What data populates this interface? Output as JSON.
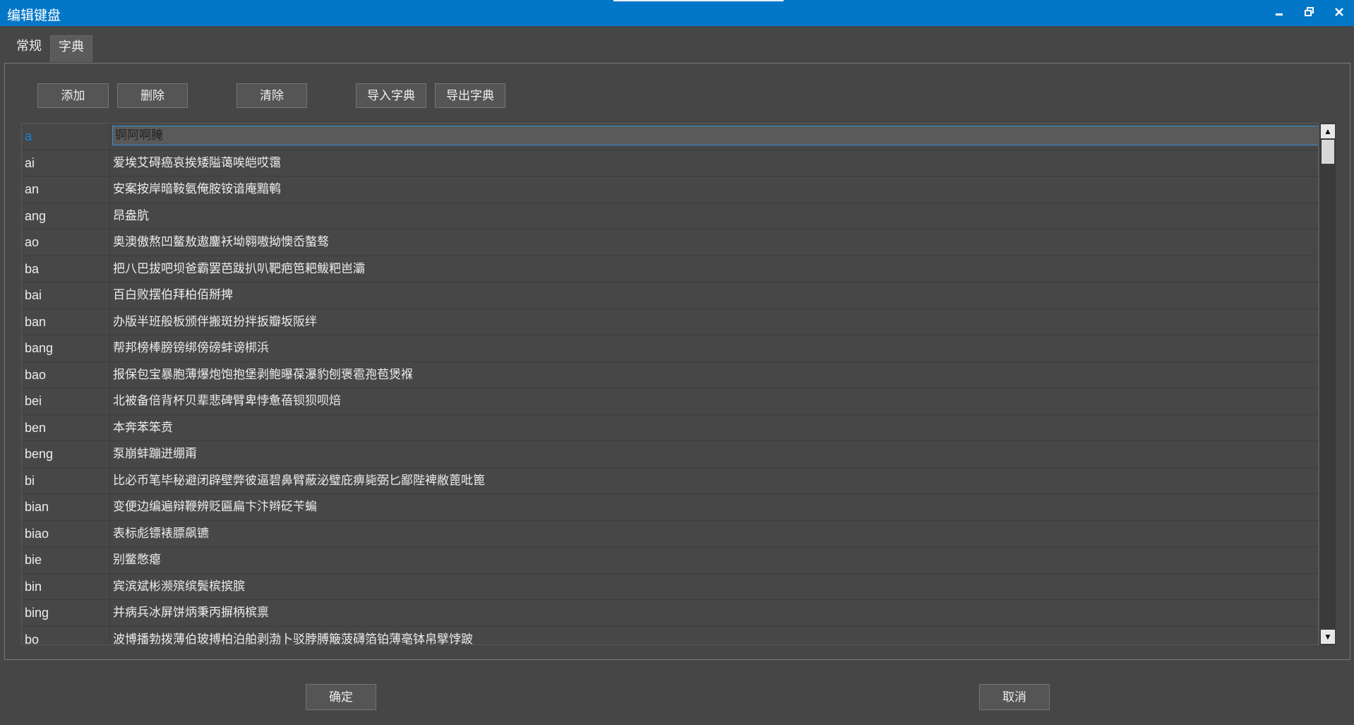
{
  "window": {
    "title": "编辑键盘"
  },
  "tabs": [
    {
      "label": "常规"
    },
    {
      "label": "字典"
    }
  ],
  "toolbar": {
    "add": "添加",
    "delete": "删除",
    "clear": "清除",
    "import": "导入字典",
    "export": "导出字典"
  },
  "edit_value": "锕阿啊腌",
  "rows": [
    {
      "key": "a",
      "value": "锕阿啊腌"
    },
    {
      "key": "ai",
      "value": "爱埃艾碍癌哀挨矮隘蔼唉皑哎霭"
    },
    {
      "key": "an",
      "value": "安案按岸暗鞍氨俺胺铵谙庵黯鹌"
    },
    {
      "key": "ang",
      "value": "昂盎肮"
    },
    {
      "key": "ao",
      "value": "奥澳傲熬凹鳌敖遨鏖袄坳翱嗷拗懊岙螯骜"
    },
    {
      "key": "ba",
      "value": "把八巴拔吧坝爸霸罢芭跋扒叭靶疤笆耙鲅粑岜灞"
    },
    {
      "key": "bai",
      "value": "百白败摆伯拜柏佰掰捭"
    },
    {
      "key": "ban",
      "value": "办版半班般板颁伴搬斑扮拌扳瓣坂阪绊"
    },
    {
      "key": "bang",
      "value": "帮邦榜棒膀镑绑傍磅蚌谤梆浜"
    },
    {
      "key": "bao",
      "value": "报保包宝暴胞薄爆炮饱抱堡剥鲍曝葆瀑豹刨褒雹孢苞煲褓"
    },
    {
      "key": "bei",
      "value": "北被备倍背杯贝辈悲碑臂卑悖惫蓓钡狈呗焙"
    },
    {
      "key": "ben",
      "value": "本奔苯笨贲"
    },
    {
      "key": "beng",
      "value": "泵崩蚌蹦迸绷甭"
    },
    {
      "key": "bi",
      "value": "比必币笔毕秘避闭辟壁弊彼逼碧鼻臂蔽泌璧庇痹毙弼匕鄙陛裨敝蓖吡篦"
    },
    {
      "key": "bian",
      "value": "变便边编遍辩鞭辨贬匾扁卞汴辫砭苄蝙"
    },
    {
      "key": "biao",
      "value": "表标彪镖裱膘飙镳"
    },
    {
      "key": "bie",
      "value": "别鳖憋瘪"
    },
    {
      "key": "bin",
      "value": "宾滨斌彬濒殡缤鬓槟摈膑"
    },
    {
      "key": "bing",
      "value": "并病兵冰屏饼炳秉丙摒柄槟禀"
    },
    {
      "key": "bo",
      "value": "波博播勃拨薄伯玻搏柏泊舶剥渤卜驳脖膊簸菠礴箔铂薄亳钵帛擘饽跛"
    }
  ],
  "footer": {
    "ok": "确定",
    "cancel": "取消"
  }
}
